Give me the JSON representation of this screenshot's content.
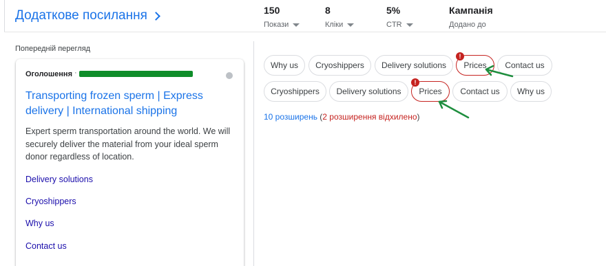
{
  "header": {
    "title": "Додаткове посилання",
    "metrics": [
      {
        "value": "150",
        "label": "Покази"
      },
      {
        "value": "8",
        "label": "Кліки"
      },
      {
        "value": "5%",
        "label": "CTR"
      },
      {
        "value": "Кампанія",
        "label": "Додано до"
      }
    ]
  },
  "preview": {
    "label": "Попередній перегляд",
    "ad_badge": "Оголошення",
    "ad_separator": "·",
    "headline": "Transporting frozen sperm | Express delivery | International shipping",
    "description": "Expert sperm transportation around the world. We will securely deliver the material from your ideal sperm donor regardless of location.",
    "sitelinks": [
      "Delivery solutions",
      "Cryoshippers",
      "Why us",
      "Contact us"
    ]
  },
  "chips_row1": [
    "Why us",
    "Cryoshippers",
    "Delivery solutions",
    "Prices",
    "Contact us"
  ],
  "chips_row2": [
    "Cryoshippers",
    "Delivery solutions",
    "Prices",
    "Contact us",
    "Why us"
  ],
  "error_icon": "!",
  "summary": {
    "count": "10 розширень",
    "open_paren": " (",
    "rejected": "2 розширення відхилено",
    "close_paren": ")"
  },
  "colors": {
    "accent": "#1a73e8",
    "error": "#c5221f",
    "arrow": "#1e8e3e",
    "redaction": "#0f8d2a"
  }
}
